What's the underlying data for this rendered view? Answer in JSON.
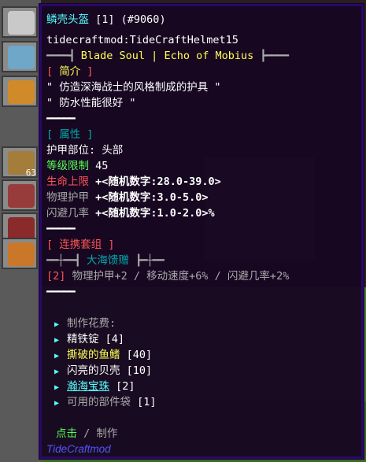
{
  "tooltip": {
    "title": "鳞壳头盔",
    "count": "[1]",
    "id": "(#9060)",
    "registry": "tidecraftmod:TideCraftHelmet15",
    "set_header_left": "━━━━┫",
    "set_header_text": "Blade Soul | Echo of Mobius",
    "set_header_right": "┣━━━━",
    "intro_heading_open": "[",
    "intro_heading": "简介",
    "intro_heading_close": "]",
    "intro_line1": "\" 仿造深海战士的风格制成的护具 \"",
    "intro_line2": "\" 防水性能很好 \"",
    "short_sep": "━━━━━",
    "attr_heading_open": "[",
    "attr_heading": "属性",
    "attr_heading_close": "]",
    "slot_label": "护甲部位: 头部",
    "level_label": "等级限制",
    "level_value": "45",
    "stats": [
      {
        "label": "生命上限",
        "value": "+<随机数字:28.0-39.0>"
      },
      {
        "label": "物理护甲",
        "value": "+<随机数字:3.0-5.0>"
      },
      {
        "label": "闪避几率",
        "value": "+<随机数字:1.0-2.0>%"
      }
    ],
    "set_heading_open": "[",
    "set_heading": "连携套组",
    "set_heading_close": "]",
    "set_name_left": "━━┼━━┫",
    "set_name": "大海馈赠",
    "set_name_right": "┣━┼━━",
    "set_bonus_count": "[2]",
    "set_bonus_text": "物理护甲+2 / 移动速度+6% / 闪避几率+2%",
    "craft_heading": "制作花费:",
    "materials": [
      {
        "name": "精铁锭",
        "count": "[4]"
      },
      {
        "name": "撕破的鱼鳍",
        "count": "[40]"
      },
      {
        "name": "闪亮的贝壳",
        "count": "[10]"
      },
      {
        "name": "瀚海宝珠",
        "count": "[2]"
      },
      {
        "name": "可用的部件袋",
        "count": "[1]"
      }
    ],
    "action_click": "点击",
    "action_sep": "/",
    "action_craft": "制作",
    "mod_name": "TideCraftmod"
  },
  "background": {
    "stack_count": "63"
  }
}
